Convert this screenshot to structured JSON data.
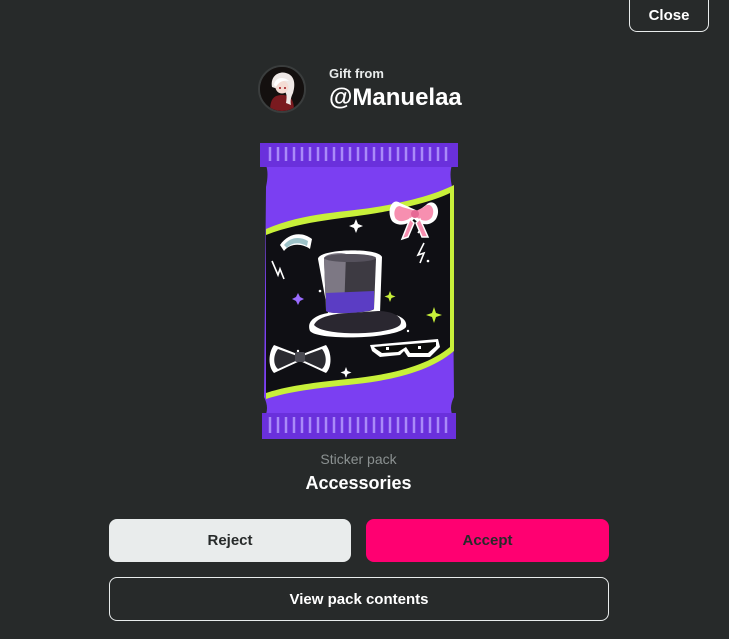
{
  "close_label": "Close",
  "gift": {
    "from_label": "Gift from",
    "username": "@Manuelaa"
  },
  "pack": {
    "type_label": "Sticker pack",
    "name": "Accessories",
    "stickers": [
      "top-hat-sticker",
      "bow-sticker",
      "bow-tie-sticker",
      "pixel-sunglasses-sticker",
      "tiara-sticker"
    ]
  },
  "actions": {
    "reject_label": "Reject",
    "accept_label": "Accept",
    "view_contents_label": "View pack contents"
  },
  "colors": {
    "background": "#272a2a",
    "accent": "#ff0071",
    "light_button": "#e9ecec",
    "pack_purple": "#7b3ff2",
    "pack_lime": "#c8f03a"
  }
}
